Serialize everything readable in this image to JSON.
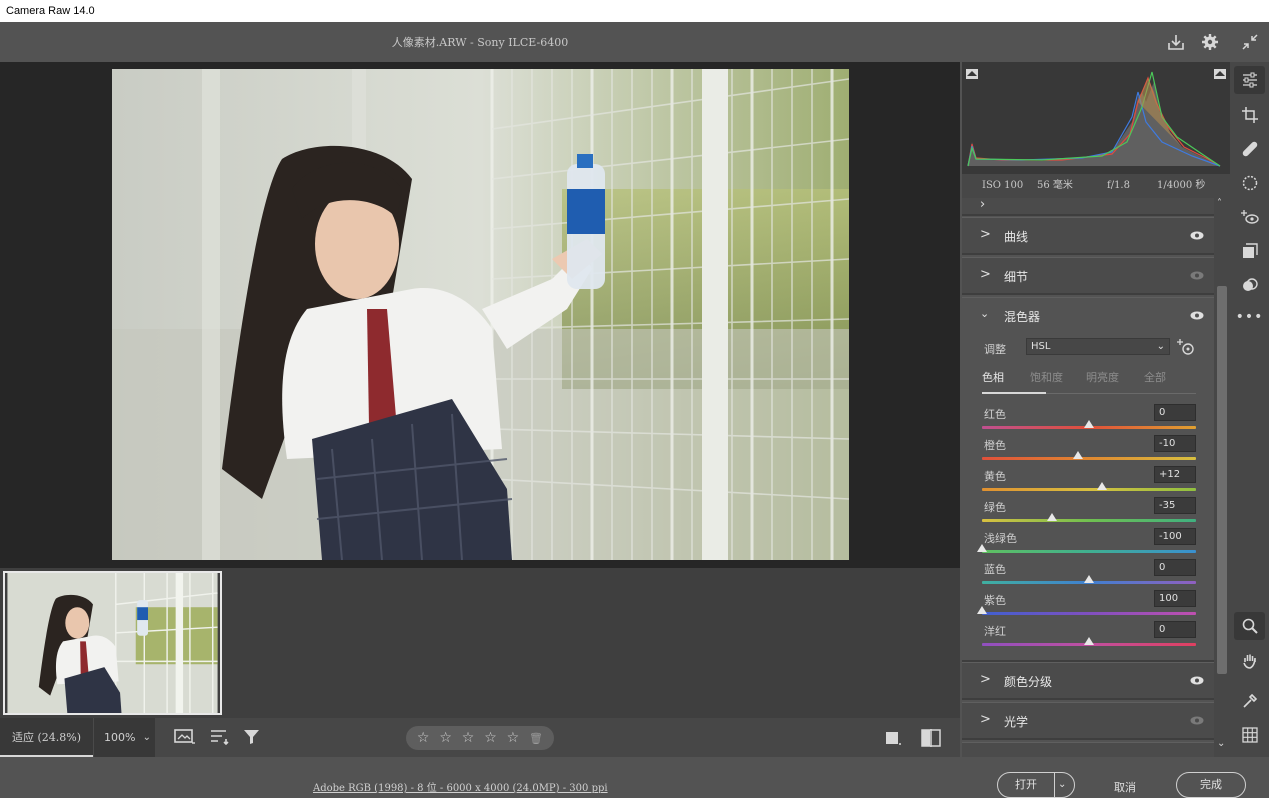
{
  "window": {
    "title": "Camera Raw 14.0"
  },
  "header": {
    "filename": "人像素材.ARW  -   Sony ILCE-6400"
  },
  "icons": {
    "save": "save-download-icon",
    "settings": "gear-icon",
    "collapse": "collapse-arrows-icon"
  },
  "bottom_bar": {
    "zoom_fit": "适应 (24.8%)",
    "zoom_100": "100%",
    "stars": [
      "☆",
      "☆",
      "☆",
      "☆",
      "☆"
    ],
    "trash": "🗑"
  },
  "footer": {
    "file_info": "Adobe RGB (1998) - 8 位 - 6000 x 4000 (24.0MP) - 300 ppi",
    "open": "打开",
    "cancel": "取消",
    "done": "完成"
  },
  "metadata": {
    "iso": "ISO 100",
    "focal": "56 毫米",
    "aperture": "f/1.8",
    "shutter": "1/4000 秒"
  },
  "sections": {
    "curve": "曲线",
    "detail": "细节",
    "mixer": "混色器",
    "grading": "颜色分级",
    "optics": "光学"
  },
  "mixer": {
    "adjust_label": "调整",
    "adjust_value": "HSL",
    "tabs": [
      "色相",
      "饱和度",
      "明亮度",
      "全部"
    ],
    "sliders": [
      {
        "label": "红色",
        "value": "0",
        "pos": 0.5
      },
      {
        "label": "橙色",
        "value": "-10",
        "pos": 0.45
      },
      {
        "label": "黄色",
        "value": "+12",
        "pos": 0.56
      },
      {
        "label": "绿色",
        "value": "-35",
        "pos": 0.325
      },
      {
        "label": "浅绿色",
        "value": "-100",
        "pos": 0.0
      },
      {
        "label": "蓝色",
        "value": "0",
        "pos": 0.5
      },
      {
        "label": "紫色",
        "value": "100",
        "pos": 0.0
      },
      {
        "label": "洋红",
        "value": "0",
        "pos": 0.5
      }
    ]
  },
  "colors": {
    "accent": "#e8e8e8",
    "panel": "#535353",
    "canvas": "#262626"
  }
}
